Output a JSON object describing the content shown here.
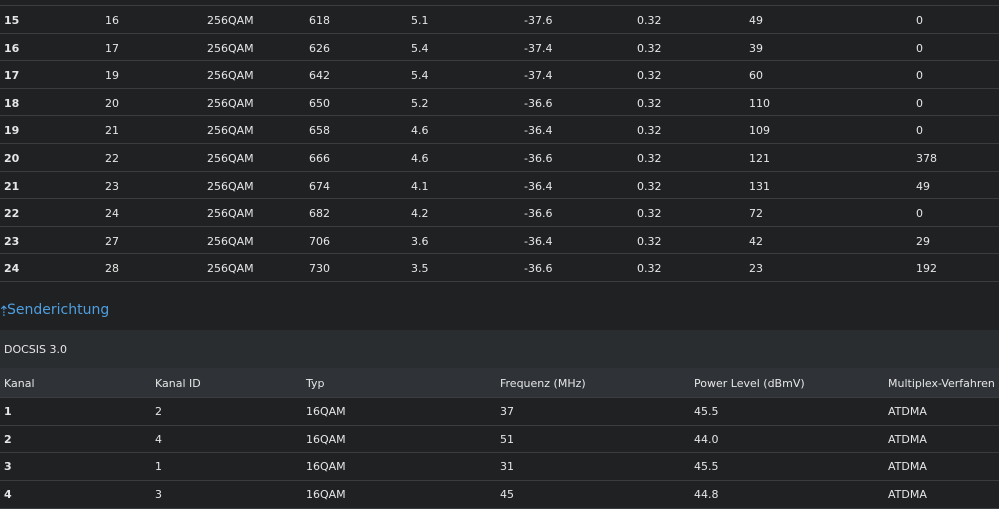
{
  "downstream_rows": [
    [
      "15",
      "16",
      "256QAM",
      "618",
      "5.1",
      "-37.6",
      "0.32",
      "49",
      "0"
    ],
    [
      "16",
      "17",
      "256QAM",
      "626",
      "5.4",
      "-37.4",
      "0.32",
      "39",
      "0"
    ],
    [
      "17",
      "19",
      "256QAM",
      "642",
      "5.4",
      "-37.4",
      "0.32",
      "60",
      "0"
    ],
    [
      "18",
      "20",
      "256QAM",
      "650",
      "5.2",
      "-36.6",
      "0.32",
      "110",
      "0"
    ],
    [
      "19",
      "21",
      "256QAM",
      "658",
      "4.6",
      "-36.4",
      "0.32",
      "109",
      "0"
    ],
    [
      "20",
      "22",
      "256QAM",
      "666",
      "4.6",
      "-36.6",
      "0.32",
      "121",
      "378"
    ],
    [
      "21",
      "23",
      "256QAM",
      "674",
      "4.1",
      "-36.4",
      "0.32",
      "131",
      "49"
    ],
    [
      "22",
      "24",
      "256QAM",
      "682",
      "4.2",
      "-36.6",
      "0.32",
      "72",
      "0"
    ],
    [
      "23",
      "27",
      "256QAM",
      "706",
      "3.6",
      "-36.4",
      "0.32",
      "42",
      "29"
    ],
    [
      "24",
      "28",
      "256QAM",
      "730",
      "3.5",
      "-36.6",
      "0.32",
      "23",
      "192"
    ]
  ],
  "upstream": {
    "section_title": "Senderichtung",
    "docsis_label": "DOCSIS 3.0",
    "headers": [
      "Kanal",
      "Kanal ID",
      "Typ",
      "Frequenz (MHz)",
      "Power Level (dBmV)",
      "Multiplex-Verfahren"
    ],
    "rows": [
      [
        "1",
        "2",
        "16QAM",
        "37",
        "45.5",
        "ATDMA"
      ],
      [
        "2",
        "4",
        "16QAM",
        "51",
        "44.0",
        "ATDMA"
      ],
      [
        "3",
        "1",
        "16QAM",
        "31",
        "45.5",
        "ATDMA"
      ],
      [
        "4",
        "3",
        "16QAM",
        "45",
        "44.8",
        "ATDMA"
      ]
    ]
  },
  "icons": {
    "section_arrow": "upload-arrow-icon"
  },
  "colors": {
    "accent": "#4f9fe0",
    "background": "#1f2123",
    "header_bg": "#2f3337"
  }
}
